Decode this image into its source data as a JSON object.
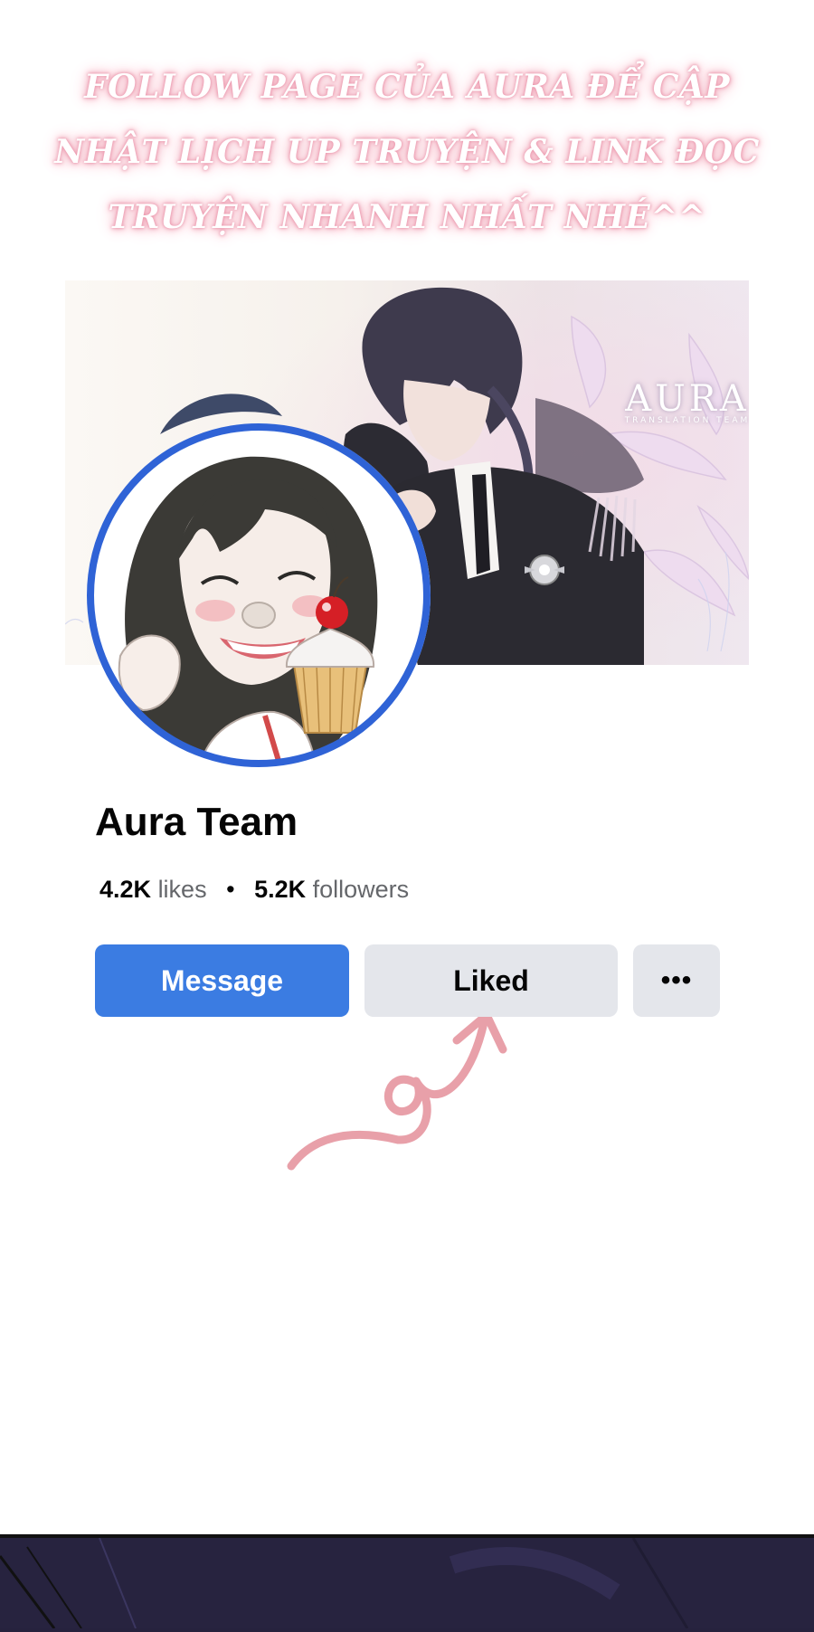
{
  "banner": {
    "lines": [
      "FOLLOW PAGE CỦA AURA ĐỂ CẬP",
      "NHẬT LỊCH UP TRUYỆN  & LINK ĐỌC",
      "TRUYỆN NHANH NHẤT NHÉ^^"
    ]
  },
  "cover": {
    "logo": "AURA",
    "logo_subtitle": "TRANSLATION TEAM"
  },
  "page": {
    "name": "Aura Team",
    "likes_count": "4.2K",
    "likes_label": "likes",
    "separator": "•",
    "followers_count": "5.2K",
    "followers_label": "followers"
  },
  "actions": {
    "message_label": "Message",
    "liked_label": "Liked",
    "more_label": "•••"
  },
  "colors": {
    "accent_blue": "#3b7ce2",
    "avatar_ring": "#2f63d6",
    "secondary_button": "#e4e6eb",
    "arrow_pink": "#e8a0a9",
    "banner_glow": "#f1a8ba"
  },
  "icons": {
    "more": "more-horizontal-icon",
    "arrow": "curly-heart-arrow-icon"
  }
}
